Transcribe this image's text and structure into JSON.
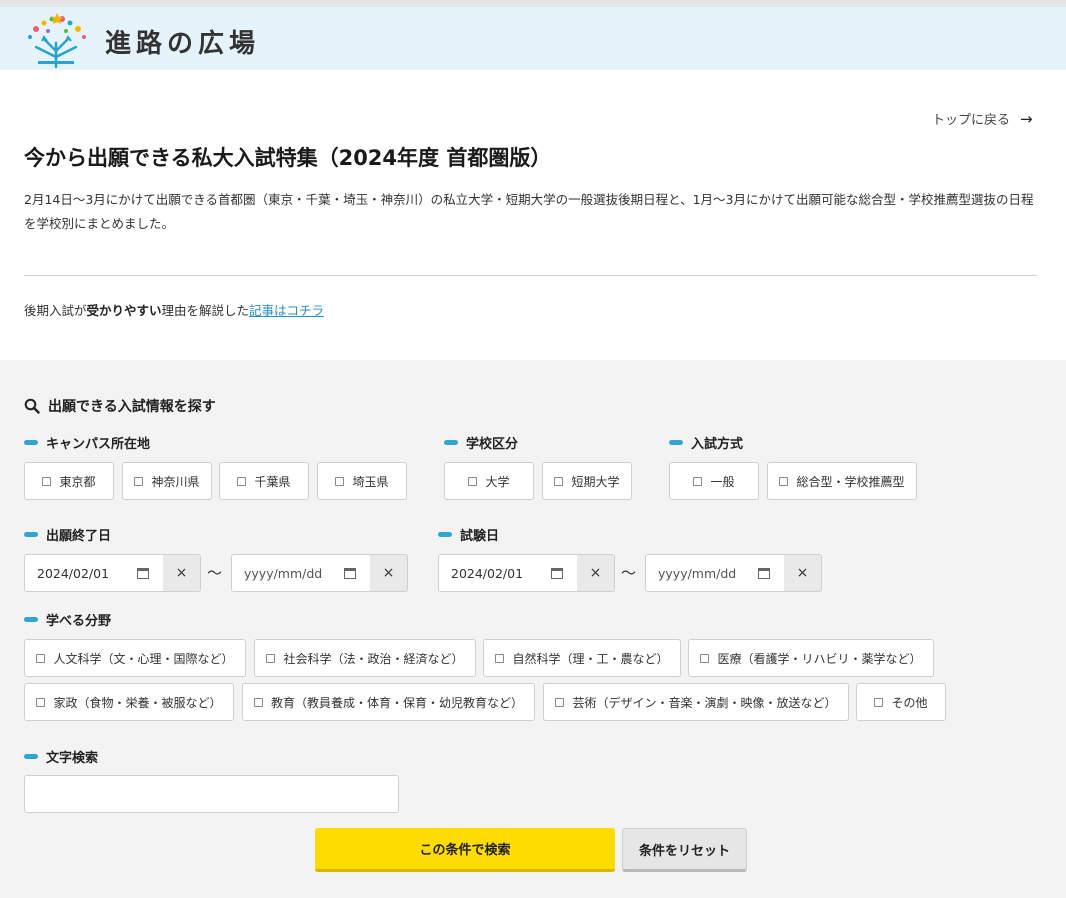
{
  "header": {
    "brand": "進路の広場"
  },
  "nav": {
    "back_label": "トップに戻る",
    "back_arrow": "→"
  },
  "page": {
    "title": "今から出願できる私大入試特集（2024年度 首都圏版）",
    "intro": "2月14日～3月にかけて出願できる首都圏（東京・千葉・埼玉・神奈川）の私立大学・短期大学の一般選抜後期日程と、1月～3月にかけて出願可能な総合型・学校推薦型選抜の日程を学校別にまとめました。",
    "note_prefix": "後期入試が",
    "note_bold": "受かりやすい",
    "note_mid": "理由を解説した",
    "note_link": "記事はコチラ"
  },
  "search": {
    "title": "出願できる入試情報を探す",
    "campus": {
      "label": "キャンパス所在地",
      "options": [
        "東京都",
        "神奈川県",
        "千葉県",
        "埼玉県"
      ]
    },
    "school_type": {
      "label": "学校区分",
      "options": [
        "大学",
        "短期大学"
      ]
    },
    "exam_method": {
      "label": "入試方式",
      "options": [
        "一般",
        "総合型・学校推薦型"
      ]
    },
    "deadline": {
      "label": "出願終了日",
      "from": "2024/02/01",
      "to": "yyyy/mm/dd"
    },
    "exam_date": {
      "label": "試験日",
      "from": "2024/02/01",
      "to": "yyyy/mm/dd"
    },
    "clear_symbol": "×",
    "range_symbol": "～",
    "fields": {
      "label": "学べる分野",
      "options": [
        "人文科学（文・心理・国際など）",
        "社会科学（法・政治・経済など）",
        "自然科学（理・工・農など）",
        "医療（看護学・リハビリ・薬学など）",
        "家政（食物・栄養・被服など）",
        "教育（教員養成・体育・保育・幼児教育など）",
        "芸術（デザイン・音楽・演劇・映像・放送など）",
        "その他"
      ]
    },
    "keyword": {
      "label": "文字検索",
      "value": ""
    },
    "submit_label": "この条件で検索",
    "reset_label": "条件をリセット"
  },
  "colors": {
    "header_bg": "#e5f4fb",
    "accent": "#33a6d0",
    "search_button": "#ffdc00",
    "panel_bg": "#f3f3f3",
    "link": "#2a8fc2"
  }
}
